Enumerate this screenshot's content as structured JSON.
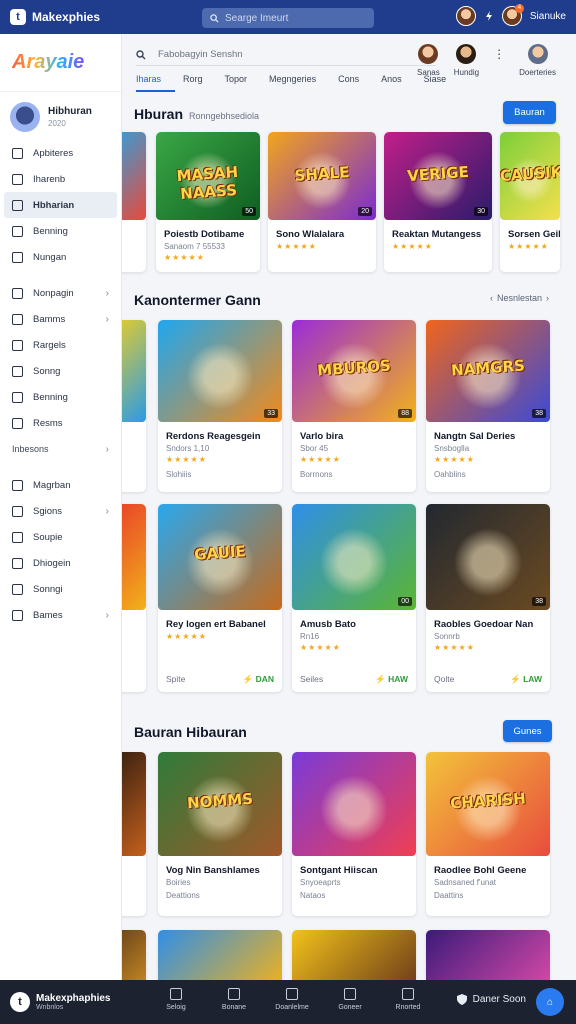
{
  "topbar": {
    "logo_glyph": "t",
    "app_title": "Makexphies",
    "search_placeholder": "Searge Imeurt",
    "notification_count": "4",
    "user_name": "Sianuke"
  },
  "sidebar": {
    "brand": "Arayaie",
    "profile": {
      "name": "Hibhuran",
      "sub": "2020"
    },
    "items": [
      {
        "label": "Apbiteres",
        "icon": "rocket-icon",
        "chevron": false
      },
      {
        "label": "Iharenb",
        "icon": "square-icon",
        "chevron": false
      },
      {
        "label": "Hbharian",
        "icon": "tag-icon",
        "chevron": false,
        "active": true
      },
      {
        "label": "Benning",
        "icon": "card-icon",
        "chevron": false
      },
      {
        "label": "Nungan",
        "icon": "list-icon",
        "chevron": false
      }
    ],
    "items2": [
      {
        "label": "Nonpagin",
        "icon": "grid-icon",
        "chevron": true
      },
      {
        "label": "Bamms",
        "icon": "clock-icon",
        "chevron": true
      },
      {
        "label": "Rargels",
        "icon": "book-icon",
        "chevron": false
      },
      {
        "label": "Sonng",
        "icon": "box-icon",
        "chevron": false
      },
      {
        "label": "Benning",
        "icon": "gift-icon",
        "chevron": false
      },
      {
        "label": "Resms",
        "icon": "doc-icon",
        "chevron": false
      }
    ],
    "section_label": "Inbesons",
    "items3": [
      {
        "label": "Magrban",
        "icon": "gamepad-icon",
        "chevron": false
      },
      {
        "label": "Sgions",
        "icon": "music-icon",
        "chevron": true
      },
      {
        "label": "Soupie",
        "icon": "page-icon",
        "chevron": false
      },
      {
        "label": "Dhiogein",
        "icon": "monitor-icon",
        "chevron": false
      },
      {
        "label": "Sonngi",
        "icon": "sheet-icon",
        "chevron": false
      },
      {
        "label": "Bames",
        "icon": "menu-icon",
        "chevron": true
      }
    ]
  },
  "subheader": {
    "search_placeholder": "Fabobagyin Senshn",
    "tabs": [
      "Iharas",
      "Rorg",
      "Topor",
      "Megngeries",
      "Cons",
      "Anos",
      "Siase"
    ],
    "active_tab": 0,
    "users": [
      {
        "label": "Sanas"
      },
      {
        "label": "Hundig"
      },
      {
        "label": "Doerteries"
      }
    ]
  },
  "sections": [
    {
      "title": "Hburan",
      "subtitle": "Ronngebhsediola",
      "button": "Bauran",
      "cards": [
        {
          "title": "Poiestb Dotibame",
          "meta": "Sanaom 7 55533",
          "stars": "★★★★★",
          "art_title": "MASAH NAASS",
          "badge": "50",
          "colors": [
            "#3aa745",
            "#0f5e22"
          ]
        },
        {
          "title": "Sono Wlalalara",
          "meta": "",
          "stars": "★★★★★",
          "art_title": "SHALE",
          "badge": "20",
          "colors": [
            "#f2a51b",
            "#7b2bd1"
          ]
        },
        {
          "title": "Reaktan Mutangess",
          "meta": "",
          "stars": "★★★★★",
          "art_title": "VERIGE",
          "badge": "30",
          "colors": [
            "#c21f8a",
            "#2a1b6b"
          ]
        },
        {
          "title": "Sorsen Geilor",
          "meta": "",
          "stars": "★★★★★",
          "art_title": "CAUSIKIE",
          "badge": "",
          "colors": [
            "#7ccf3a",
            "#f4e04d"
          ]
        }
      ]
    },
    {
      "title": "Kanontermer Gann",
      "button": "Nesnlestan",
      "cards": [
        {
          "title": "Rerdons Reagesgein",
          "meta": "Sndors 1,10",
          "stars": "★★★★★",
          "foot": "Slohiiis",
          "art_title": "",
          "badge": "33",
          "colors": [
            "#1ea7f0",
            "#f38a1a"
          ]
        },
        {
          "title": "Varlo bira",
          "meta": "Sbor 45",
          "stars": "★★★★★",
          "foot": "Borrnons",
          "art_title": "MBUROS",
          "badge": "88",
          "colors": [
            "#9b2bd6",
            "#f2b21a"
          ]
        },
        {
          "title": "Nangtn Sal Deries",
          "meta": "Snsboglla",
          "stars": "★★★★★",
          "foot": "Oahblins",
          "art_title": "NAMGRS",
          "badge": "38",
          "colors": [
            "#f0651b",
            "#3b4ad6"
          ]
        }
      ]
    },
    {
      "cards": [
        {
          "title": "Rey logen ert Babanel",
          "meta": "",
          "stars": "★★★★★",
          "foot_left": "Spite",
          "foot_right": "DAN",
          "art_title": "GAUIE",
          "badge": "",
          "colors": [
            "#29a8ee",
            "#c56b1d"
          ]
        },
        {
          "title": "Amusb Bato",
          "meta": "Rn16",
          "stars": "★★★★★",
          "foot_left": "Seiles",
          "foot_right": "HAW",
          "art_title": "",
          "badge": "00",
          "colors": [
            "#2f8fe8",
            "#5bb532"
          ]
        },
        {
          "title": "Raobles Goedoar Nan",
          "meta": "Sonnrb",
          "stars": "★★★★★",
          "foot_left": "Qolte",
          "foot_right": "LAW",
          "art_title": "",
          "badge": "38",
          "colors": [
            "#222830",
            "#6b4a22"
          ]
        }
      ]
    },
    {
      "title": "Bauran Hibauran",
      "button": "Gunes",
      "cards": [
        {
          "title": "Vog Nin Banshlames",
          "meta": "Boiries",
          "foot": "Deattions",
          "art_title": "NOMMS",
          "badge": "",
          "colors": [
            "#2f7b3a",
            "#a0582a"
          ]
        },
        {
          "title": "Sontgant Hiiscan",
          "meta": "Snyoeaprts",
          "foot": "Nataos",
          "art_title": "",
          "badge": "",
          "colors": [
            "#7a3bd8",
            "#f03e52"
          ]
        },
        {
          "title": "Raodlee Bohl Geene",
          "meta": "Sadnsaned f'unat",
          "foot": "Daattins",
          "art_title": "CHARISH",
          "badge": "",
          "colors": [
            "#f3c33a",
            "#e84c3d"
          ]
        }
      ]
    }
  ],
  "bottombar": {
    "brand": "Makexphaphies",
    "brand_sub": "Wnbnlos",
    "nav": [
      "Seloig",
      "Bonane",
      "Doanlelme",
      "Goneer",
      "Rnorted"
    ],
    "right_label": "Daner Soon",
    "fab_glyph": "⌂"
  },
  "colors": {
    "topbar": "#1f3d8c",
    "accent": "#1c6fe0",
    "bottombar": "#1c2230"
  }
}
